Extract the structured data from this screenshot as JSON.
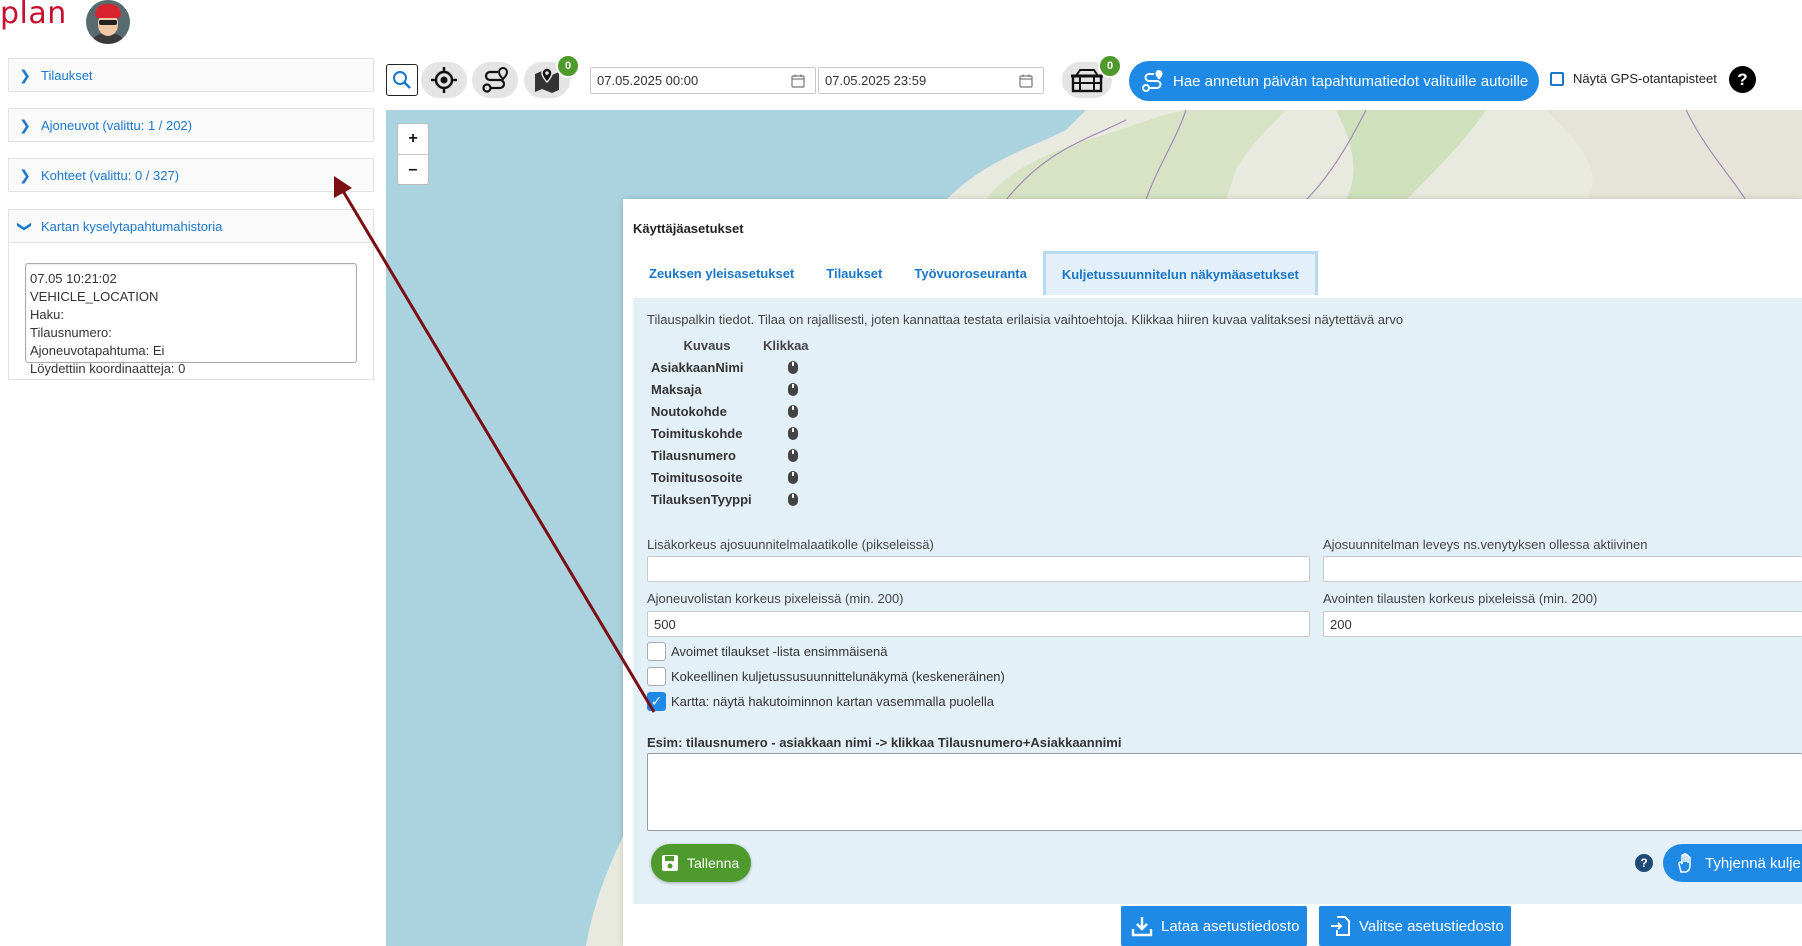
{
  "brand": {
    "logo_text": "plan"
  },
  "sidebar": {
    "panels": [
      {
        "label": "Tilaukset",
        "expanded": false
      },
      {
        "label": "Ajoneuvot (valittu: 1 / 202)",
        "expanded": false
      },
      {
        "label": "Kohteet (valittu: 0 / 327)",
        "expanded": false
      },
      {
        "label": "Kartan kyselytapahtumahistoria",
        "expanded": true
      }
    ],
    "history_lines": [
      "07.05 10:21:02",
      "VEHICLE_LOCATION",
      "Haku:",
      "Tilausnumero:",
      "Ajoneuvotapahtuma: Ei",
      "Löydettiin koordinaatteja: 0"
    ]
  },
  "toolbar": {
    "icons": [
      "search-icon",
      "locate-icon",
      "route-icon",
      "map-icon",
      "crate-icon"
    ],
    "map_badge": "0",
    "crate_badge": "0",
    "date_start": "07.05.2025 00:00",
    "date_end": "07.05.2025 23:59",
    "fetch_button_label": "Hae annetun päivän tapahtumatiedot valituille autoille",
    "gps_checkbox_label": "Näytä GPS-otantapisteet",
    "help_label": "?"
  },
  "map": {
    "zoom_in_label": "+",
    "zoom_out_label": "–"
  },
  "dialog": {
    "title": "Käyttäjäasetukset",
    "tabs": [
      {
        "label": "Zeuksen yleisasetukset",
        "active": false
      },
      {
        "label": "Tilaukset",
        "active": false
      },
      {
        "label": "Työvuoroseuranta",
        "active": false
      },
      {
        "label": "Kuljetussuunnitelun näkymäasetukset",
        "active": true
      }
    ],
    "intro": "Tilauspalkin tiedot. Tilaa on rajallisesti, joten kannattaa testata erilaisia vaihtoehtoja. Klikkaa hiiren kuvaa valitaksesi näytettävä arvo",
    "table_header_desc": "Kuvaus",
    "table_header_click": "Klikkaa",
    "field_names": [
      "AsiakkaanNimi",
      "Maksaja",
      "Noutokohde",
      "Toimituskohde",
      "Tilausnumero",
      "Toimitusosoite",
      "TilauksenTyyppi"
    ],
    "extra_height_label": "Lisäkorkeus ajosuunnitelmalaatikolle (pikseleissä)",
    "extra_height_value": "",
    "plan_width_label": "Ajosuunnitelman leveys ns.venytyksen ollessa aktiivinen",
    "plan_width_value": "",
    "vehicle_list_height_label": "Ajoneuvolistan korkeus pixeleissä (min. 200)",
    "vehicle_list_height_value": "500",
    "open_orders_height_label": "Avointen tilausten korkeus pixeleissä (min. 200)",
    "open_orders_height_value": "200",
    "checkboxes": [
      {
        "label": "Avoimet tilaukset -lista ensimmäisenä",
        "checked": false
      },
      {
        "label": "Kokeellinen kuljetussusuunnittelunäkymä (keskeneräinen)",
        "checked": false
      },
      {
        "label": "Kartta: näytä hakutoiminnon kartan vasemmalla puolella",
        "checked": true
      }
    ],
    "example_label": "Esim: tilausnumero - asiakkaan nimi -> klikkaa Tilausnumero+Asiakkaannimi",
    "example_value": "",
    "save_label": "Tallenna",
    "clear_label": "Tyhjennä kulje",
    "help_label": "?",
    "download_label": "Lataa asetustiedosto",
    "choose_file_label": "Valitse asetustiedosto"
  },
  "colors": {
    "accent": "#1e8ae6",
    "link": "#1a77c9",
    "success": "#4f9a2c",
    "brand": "#c8102e",
    "arrow": "#7a0e12"
  }
}
